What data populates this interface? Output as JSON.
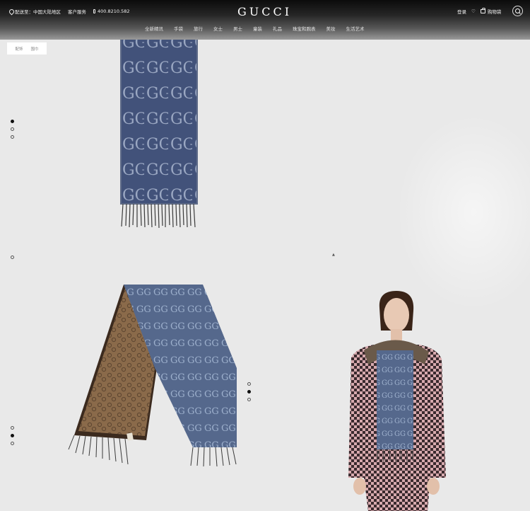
{
  "header": {
    "location_label": "配送至：中国大陆地区",
    "service_label": "客户服务",
    "phone": "400.8210.582",
    "logo": "GUCCI",
    "login_label": "登录",
    "cart_label": "购物袋"
  },
  "nav": {
    "items": [
      "全新精讯",
      "手袋",
      "旅行",
      "女士",
      "男士",
      "童装",
      "礼品",
      "珠宝和腕表",
      "美妆",
      "生活艺术"
    ]
  },
  "breadcrumb": {
    "items": [
      "配饰",
      "围巾"
    ]
  },
  "colors": {
    "background": "#e9e9e9",
    "header_dark": "#0b0b0b",
    "scarf_blue": "#4a5a78",
    "scarf_brown": "#8a6a4a"
  },
  "icons": [
    "location-pin-icon",
    "phone-icon",
    "heart-icon",
    "shopping-bag-icon",
    "search-icon"
  ]
}
